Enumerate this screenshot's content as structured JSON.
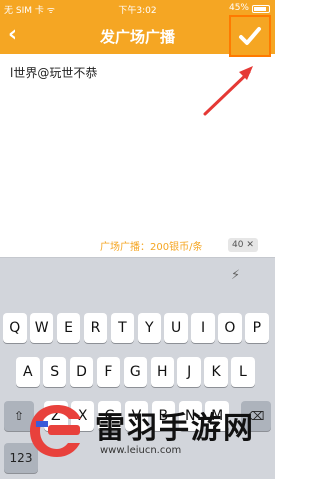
{
  "status_bar": {
    "carrier": "无 SIM 卡 ᯤ",
    "time": "下午3:02",
    "battery": "45%"
  },
  "nav": {
    "back_icon": "chevron-left-icon",
    "title": "发广场广播",
    "confirm_icon": "checkmark-icon"
  },
  "content": {
    "post_text": "l世界@玩世不恭"
  },
  "footer": {
    "cost_label": "广场广播：200银币/条",
    "char_count": "40"
  },
  "keyboard": {
    "row1": [
      "Q",
      "W",
      "E",
      "R",
      "T",
      "Y",
      "U",
      "I",
      "O",
      "P"
    ],
    "row2": [
      "A",
      "S",
      "D",
      "F",
      "G",
      "H",
      "J",
      "K",
      "L"
    ],
    "row3": [
      "Z",
      "X",
      "C",
      "V",
      "B",
      "N",
      "M"
    ],
    "shift_icon": "shift-icon",
    "delete_icon": "backspace-icon",
    "numbers_label": "123",
    "space_label": "",
    "return_label": ""
  },
  "watermark": {
    "title": "雷羽手游网",
    "url": "www.leiucn.com"
  },
  "colors": {
    "accent": "#f5a623",
    "confirm": "#ff7a00",
    "annotation": "#e53935",
    "brand": "#e8413c"
  }
}
